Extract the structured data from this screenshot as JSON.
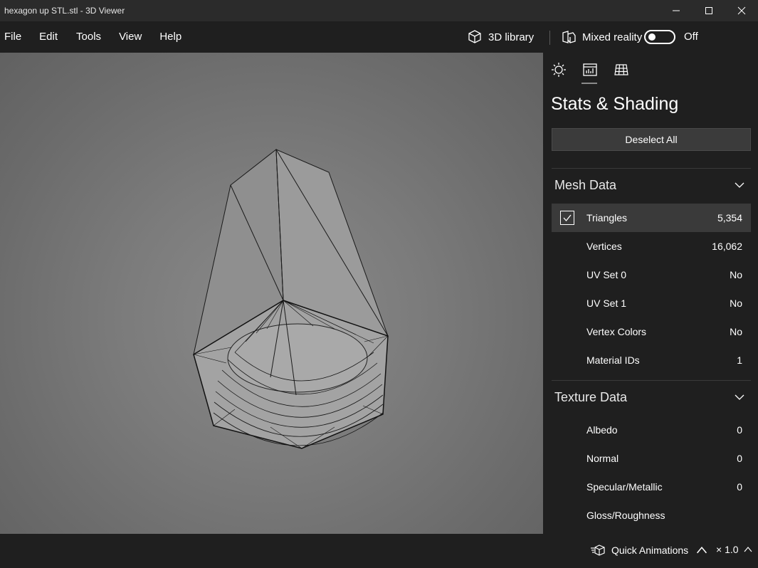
{
  "window": {
    "title": "hexagon up STL.stl - 3D Viewer",
    "minimize_icon": "minimize-icon",
    "maximize_icon": "maximize-icon",
    "close_icon": "close-icon"
  },
  "menu": {
    "items": [
      "File",
      "Edit",
      "Tools",
      "View",
      "Help"
    ]
  },
  "toolbar": {
    "library_label": "3D library",
    "library_icon": "cube-icon",
    "mixed_reality_label": "Mixed reality",
    "mixed_reality_icon": "mixed-reality-icon",
    "toggle_state": "Off"
  },
  "panel": {
    "tabs": [
      {
        "name": "lighting",
        "icon": "sun-icon"
      },
      {
        "name": "stats-shading",
        "icon": "stats-icon",
        "active": true
      },
      {
        "name": "grid",
        "icon": "grid-icon"
      }
    ],
    "title": "Stats & Shading",
    "deselect_label": "Deselect All",
    "mesh_data": {
      "header": "Mesh Data",
      "rows": [
        {
          "label": "Triangles",
          "value": "5,354",
          "checked": true
        },
        {
          "label": "Vertices",
          "value": "16,062"
        },
        {
          "label": "UV Set 0",
          "value": "No"
        },
        {
          "label": "UV Set 1",
          "value": "No"
        },
        {
          "label": "Vertex Colors",
          "value": "No"
        },
        {
          "label": "Material IDs",
          "value": "1"
        }
      ]
    },
    "texture_data": {
      "header": "Texture Data",
      "rows": [
        {
          "label": "Albedo",
          "value": "0"
        },
        {
          "label": "Normal",
          "value": "0"
        },
        {
          "label": "Specular/Metallic",
          "value": "0"
        },
        {
          "label": "Gloss/Roughness",
          "value": ""
        }
      ]
    }
  },
  "bottom": {
    "quick_animations_label": "Quick Animations",
    "speed_label": "× 1.0"
  },
  "colors": {
    "background": "#1f1f1f",
    "titlebar": "#2b2b2b",
    "selected_row": "#3a3a3a",
    "button": "#3b3b3b"
  }
}
